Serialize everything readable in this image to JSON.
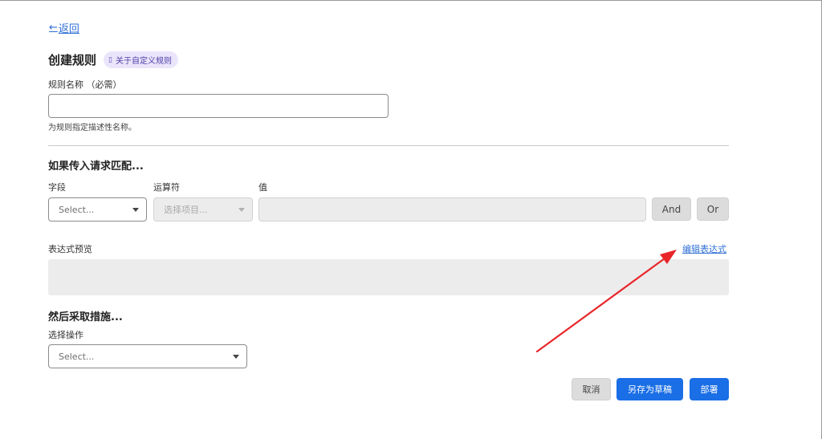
{
  "nav": {
    "back_label": "返回",
    "back_arrow": "←"
  },
  "header": {
    "title": "创建规则",
    "help_label": "关于自定义规则",
    "help_icon": "book-icon"
  },
  "rule_name": {
    "label": "规则名称 （必需）",
    "value": "",
    "hint": "为规则指定描述性名称。"
  },
  "match": {
    "title": "如果传入请求匹配...",
    "field_label": "字段",
    "operator_label": "运算符",
    "value_label": "值",
    "field_placeholder": "Select...",
    "operator_placeholder": "选择项目...",
    "and_label": "And",
    "or_label": "Or"
  },
  "preview": {
    "label": "表达式预览",
    "edit_label": "编辑表达式"
  },
  "action": {
    "title": "然后采取措施...",
    "label": "选择操作",
    "placeholder": "Select..."
  },
  "footer": {
    "cancel_label": "取消",
    "save_draft_label": "另存为草稿",
    "deploy_label": "部署"
  },
  "colors": {
    "accent": "#1a6ee6",
    "link": "#2f6fd6",
    "annotation": "#e8262a",
    "pill_bg": "#ebe5fb"
  }
}
